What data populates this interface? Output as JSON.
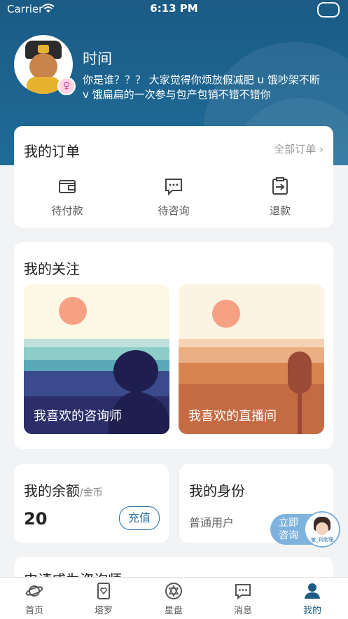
{
  "status_bar": {
    "carrier": "Carrier",
    "time": "6:13 PM"
  },
  "profile": {
    "username": "时间",
    "bio": "你是谁？？？ 大家觉得你烦放假减肥 u 饿吵架不断 v 饿扁扁的一次参与包产包销不错不错你",
    "gender_symbol": "♀"
  },
  "orders": {
    "title": "我的订单",
    "all_label": "全部订单 ›",
    "items": [
      {
        "label": "待付款",
        "icon": "wallet-icon"
      },
      {
        "label": "待咨询",
        "icon": "chat-icon"
      },
      {
        "label": "退款",
        "icon": "refund-icon"
      }
    ]
  },
  "follow": {
    "title": "我的关注",
    "tiles": [
      {
        "label": "我喜欢的咨询师"
      },
      {
        "label": "我喜欢的直播间"
      }
    ]
  },
  "balance": {
    "title": "我的余额",
    "unit": "/金币",
    "amount": "20",
    "recharge_label": "充值"
  },
  "identity": {
    "title": "我的身份",
    "value": "普通用户"
  },
  "consult_float": {
    "line1": "立即",
    "line2": "咨询",
    "caption": "敏_利助理"
  },
  "peek": {
    "title": "申请成为咨询师"
  },
  "tabbar": [
    {
      "label": "首页",
      "icon": "planet-icon",
      "active": false
    },
    {
      "label": "塔罗",
      "icon": "tarot-card-icon",
      "active": false
    },
    {
      "label": "星盘",
      "icon": "astrolabe-icon",
      "active": false
    },
    {
      "label": "消息",
      "icon": "message-icon",
      "active": false
    },
    {
      "label": "我的",
      "icon": "user-icon",
      "active": true
    }
  ],
  "colors": {
    "header": "#1b5b86",
    "accent": "#2a72a8",
    "background": "#f2f3f5"
  }
}
